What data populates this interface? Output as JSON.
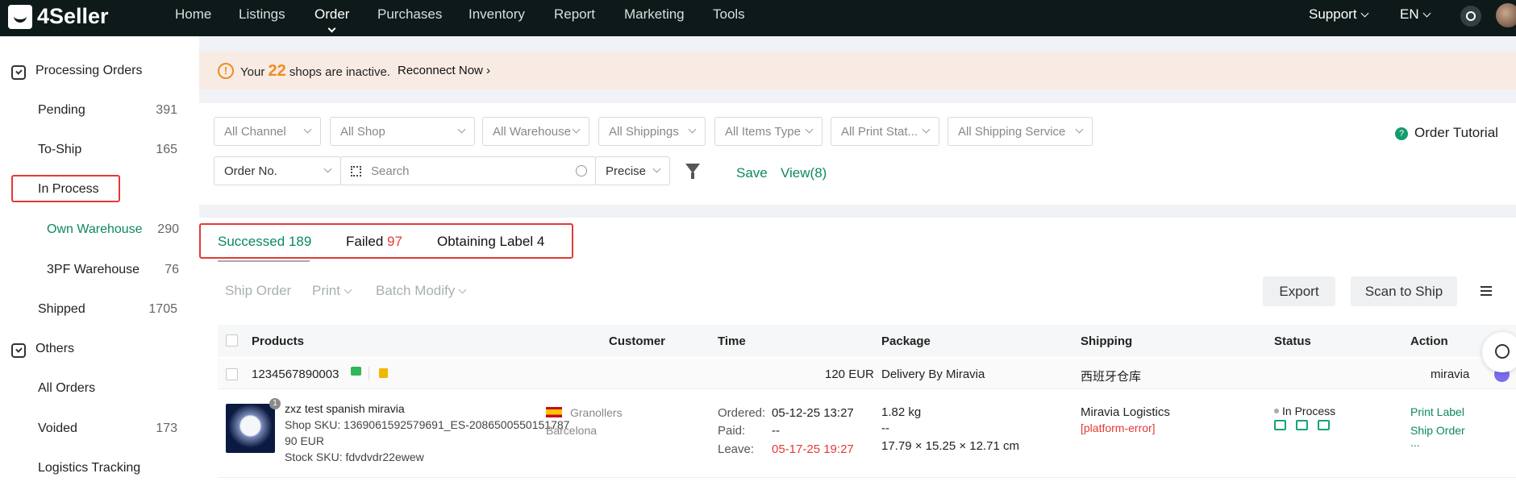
{
  "app": {
    "logo": "4Seller"
  },
  "nav": {
    "items": [
      "Home",
      "Listings",
      "Order",
      "Purchases",
      "Inventory",
      "Report",
      "Marketing",
      "Tools"
    ],
    "support": "Support",
    "lang": "EN"
  },
  "sidebar": {
    "processing": "Processing Orders",
    "pending": {
      "label": "Pending",
      "count": "391"
    },
    "to_ship": {
      "label": "To-Ship",
      "count": "165"
    },
    "in_process": {
      "label": "In Process"
    },
    "own_warehouse": {
      "label": "Own Warehouse",
      "count": "290"
    },
    "pf_warehouse": {
      "label": "3PF Warehouse",
      "count": "76"
    },
    "shipped": {
      "label": "Shipped",
      "count": "1705"
    },
    "others": "Others",
    "all_orders": {
      "label": "All Orders"
    },
    "voided": {
      "label": "Voided",
      "count": "173"
    },
    "logistics": {
      "label": "Logistics Tracking"
    }
  },
  "banner": {
    "prefix": "Your",
    "count": "22",
    "suffix": "shops are inactive.",
    "link": "Reconnect Now"
  },
  "filters": {
    "channel": "All Channel",
    "shop": "All Shop",
    "warehouse": "All Warehouse",
    "shippings": "All Shippings",
    "items_type": "All Items Type",
    "print_status": "All Print Stat...",
    "shipping_service": "All Shipping Service",
    "order_no": "Order No.",
    "search_placeholder": "Search",
    "precise": "Precise",
    "save": "Save",
    "view": "View(8)",
    "tutorial": "Order Tutorial"
  },
  "tabs": {
    "successed": {
      "label": "Successed",
      "count": "189"
    },
    "failed": {
      "label": "Failed",
      "count": "97"
    },
    "obtaining": {
      "label": "Obtaining Label",
      "count": "4"
    }
  },
  "toolbar": {
    "ship_order": "Ship Order",
    "print": "Print",
    "batch_modify": "Batch Modify",
    "export": "Export",
    "scan_to_ship": "Scan to Ship"
  },
  "table": {
    "headers": {
      "products": "Products",
      "customer": "Customer",
      "time": "Time",
      "package": "Package",
      "shipping": "Shipping",
      "status": "Status",
      "action": "Action"
    },
    "order": {
      "number": "1234567890003",
      "amount": "120 EUR",
      "delivery": "Delivery By Miravia",
      "warehouse": "西班牙仓库",
      "channel": "miravia"
    },
    "item": {
      "quantity": "1",
      "title": "zxz test spanish miravia",
      "shop_sku": "Shop SKU: 1369061592579691_ES-2086500550151787",
      "price": "90 EUR",
      "stock_sku": "Stock SKU: fdvdvdr22ewew",
      "customer_city": "Granollers",
      "customer_region": "Barcelona",
      "ordered_label": "Ordered:",
      "ordered": "05-12-25 13:27",
      "paid_label": "Paid:",
      "paid": "--",
      "leave_label": "Leave:",
      "leave": "05-17-25 19:27",
      "weight": "1.82 kg",
      "package_extra": "--",
      "dimensions": "17.79 × 15.25 × 12.71 cm",
      "carrier": "Miravia Logistics",
      "error": "[platform-error]",
      "status": "In Process",
      "print_label": "Print Label",
      "ship_order": "Ship Order",
      "more": "..."
    }
  },
  "colors": {
    "accent": "#0b8a5e",
    "warning": "#ef8c20",
    "error": "#e53935",
    "topbar": "#0e1a1a"
  }
}
